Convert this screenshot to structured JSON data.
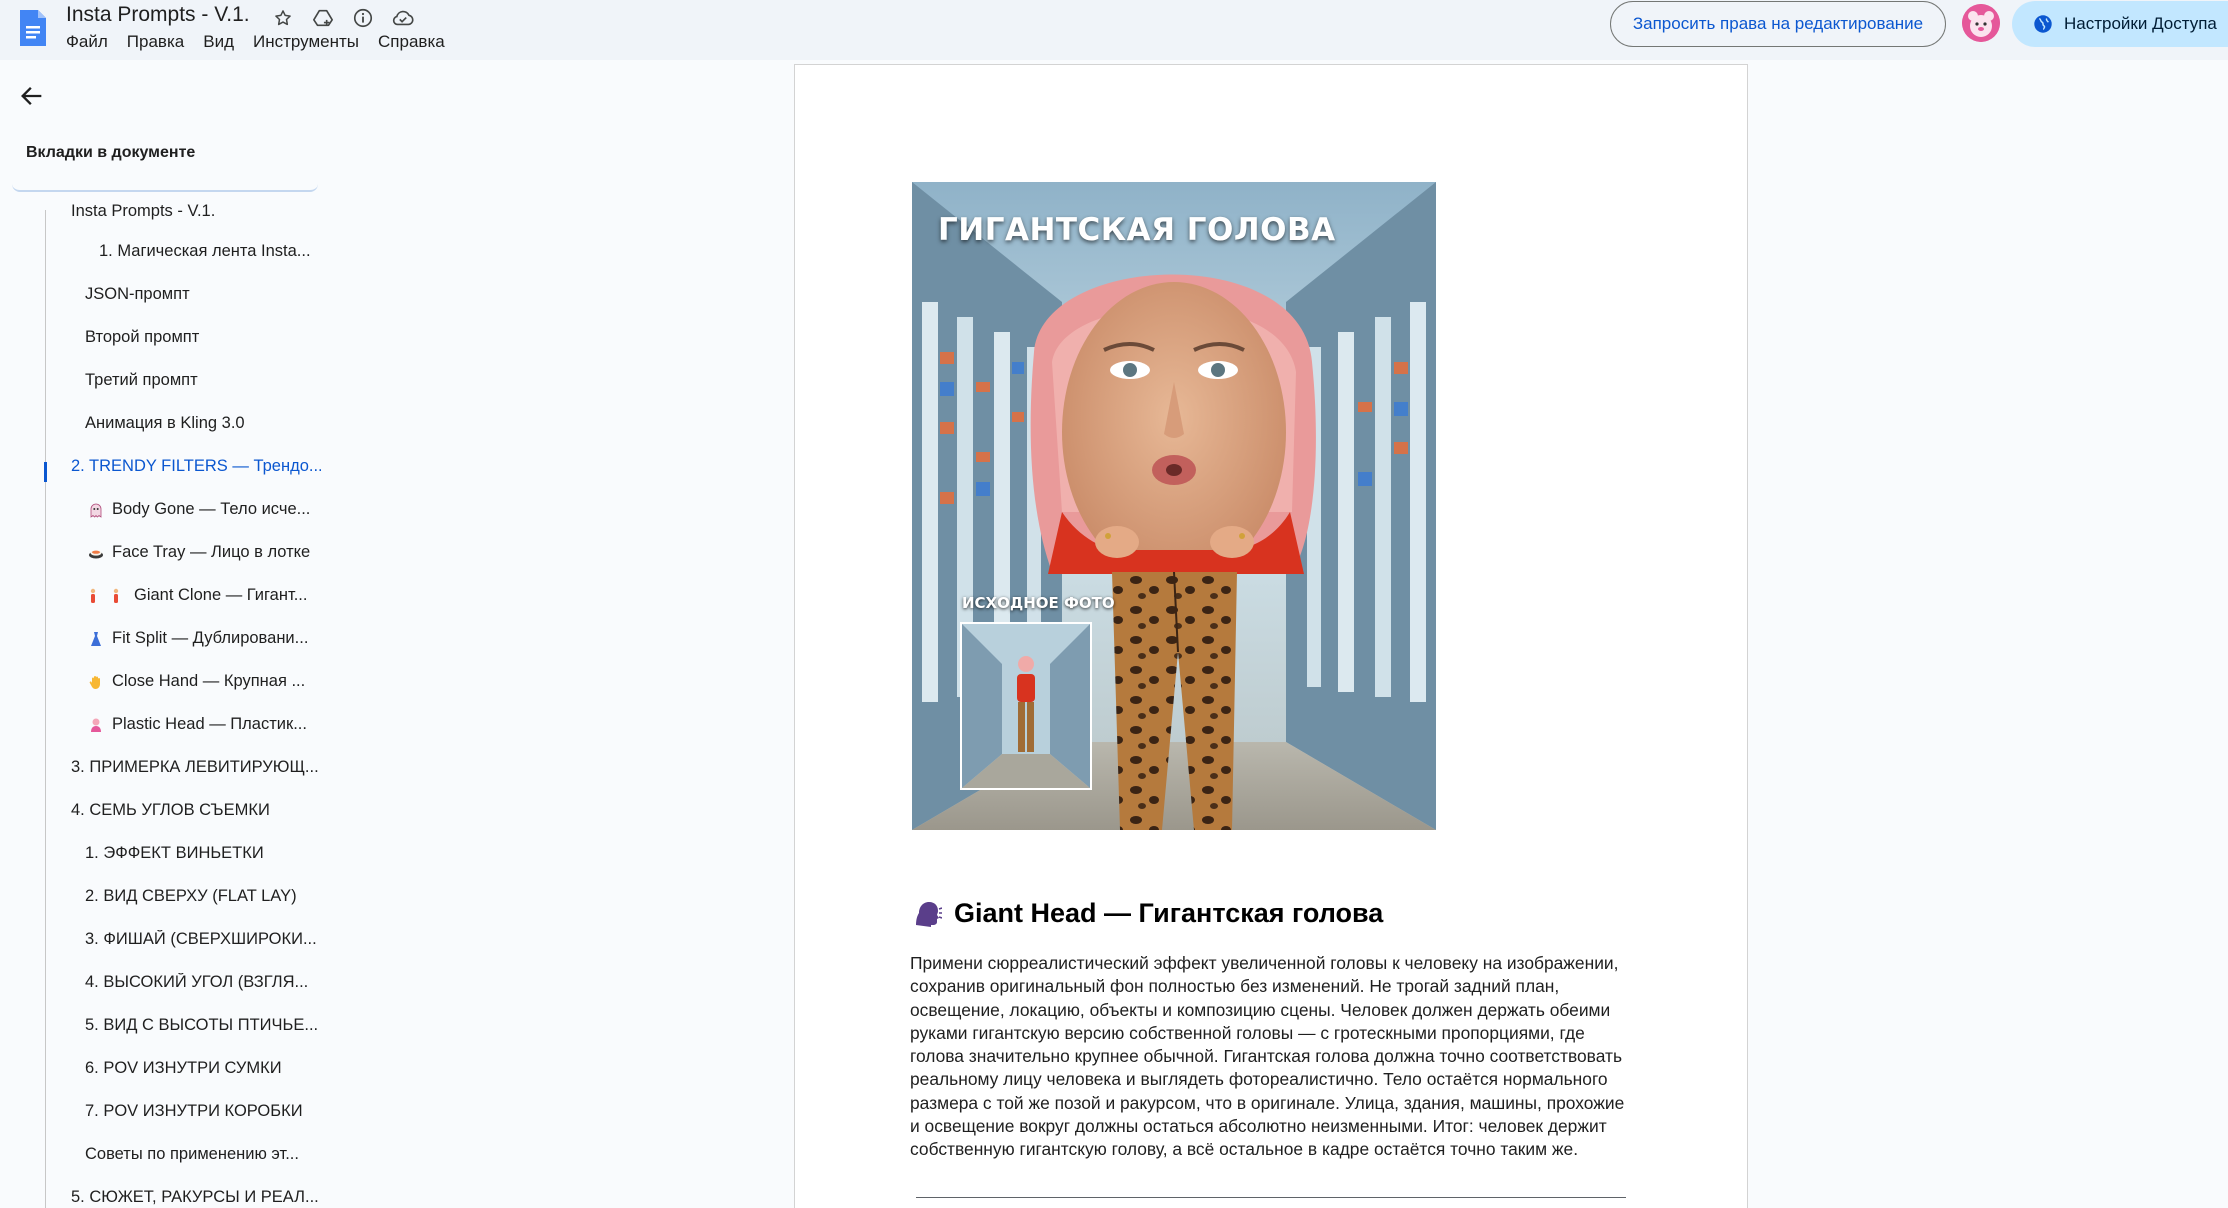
{
  "header": {
    "doc_title": "Insta Prompts - V.1.",
    "menu": [
      "Файл",
      "Правка",
      "Вид",
      "Инструменты",
      "Справка"
    ],
    "request_edit_label": "Запросить права на редактирование",
    "share_label": "Настройки Доступа",
    "icons": [
      "star-icon",
      "move-to-drive-icon",
      "info-icon",
      "cloud-saved-icon"
    ]
  },
  "sidebar": {
    "heading": "Вкладки в документе",
    "items": [
      {
        "label": "Insta Prompts - V.1.",
        "level": 0
      },
      {
        "label": "1. Магическая лента Insta...",
        "level": 2
      },
      {
        "label": "JSON-промпт",
        "level": 1
      },
      {
        "label": "Второй промпт",
        "level": 1
      },
      {
        "label": "Третий промпт",
        "level": 1
      },
      {
        "label": "Анимация в Kling 3.0",
        "level": 1
      },
      {
        "label": "2. TRENDY FILTERS — Трендо...",
        "level": 0,
        "active": true
      },
      {
        "label": "Body Gone — Тело исче...",
        "level": 1,
        "icon": "ghost-emoji"
      },
      {
        "label": "Face Tray — Лицо в лотке",
        "level": 1,
        "icon": "sushi-emoji"
      },
      {
        "label": "Giant Clone — Гигант...",
        "level": 1,
        "icon": "two-people-emoji"
      },
      {
        "label": "Fit Split — Дублировани...",
        "level": 1,
        "icon": "dress-emoji"
      },
      {
        "label": "Close Hand — Крупная ...",
        "level": 1,
        "icon": "hand-emoji"
      },
      {
        "label": "Plastic Head — Пластик...",
        "level": 1,
        "icon": "doll-emoji"
      },
      {
        "label": "3. ПРИМЕРКА ЛЕВИТИРУЮЩ...",
        "level": 0
      },
      {
        "label": "4. СЕМЬ УГЛОВ СЪЕМКИ",
        "level": 0
      },
      {
        "label": "1. ЭФФЕКТ ВИНЬЕТКИ",
        "level": 1
      },
      {
        "label": "2. ВИД СВЕРХУ (FLAT LAY)",
        "level": 1
      },
      {
        "label": "3. ФИШАЙ (СВЕРХШИРОКИ...",
        "level": 1
      },
      {
        "label": "4. ВЫСОКИЙ УГОЛ (ВЗГЛЯ...",
        "level": 1
      },
      {
        "label": "5. ВИД С ВЫСОТЫ ПТИЧЬЕ...",
        "level": 1
      },
      {
        "label": "6. POV ИЗНУТРИ СУМКИ",
        "level": 1
      },
      {
        "label": "7. POV ИЗНУТРИ КОРОБКИ",
        "level": 1
      },
      {
        "label": "Советы по применению эт...",
        "level": 1
      },
      {
        "label": "5. СЮЖЕТ, РАКУРСЫ И РЕАЛ...",
        "level": 0
      }
    ]
  },
  "document": {
    "image": {
      "title": "ГИГАНТСКАЯ ГОЛОВА",
      "inset_label": "ИСХОДНОЕ ФОТО"
    },
    "section_icon": "speaking-head-emoji",
    "section_heading": "Giant Head — Гигантская голова",
    "body_lines": [
      "Примени сюрреалистический эффект увеличенной головы к человеку на изображении,",
      "сохранив оригинальный фон полностью без изменений. Не трогай задний план,",
      "освещение, локацию, объекты и композицию сцены. Человек должен держать обеими",
      "руками гигантскую версию собственной головы — с гротескными пропорциями, где",
      "голова значительно крупнее обычной. Гигантская голова должна точно соответствовать",
      "реальному лицу человека и выглядеть фотореалистично. Тело остаётся нормального",
      "размера с той же позой и ракурсом, что в оригинале. Улица, здания, машины, прохожие",
      "и освещение вокруг должны остаться абсолютно неизменными. Итог: человек держит",
      "собственную гигантскую голову, а всё остальное в кадре остаётся точно таким же."
    ]
  },
  "colors": {
    "topbar_bg": "#f0f4f9",
    "accent": "#0b57d0",
    "share_bg": "#c2e7ff",
    "avatar_bg": "#e5589a"
  }
}
